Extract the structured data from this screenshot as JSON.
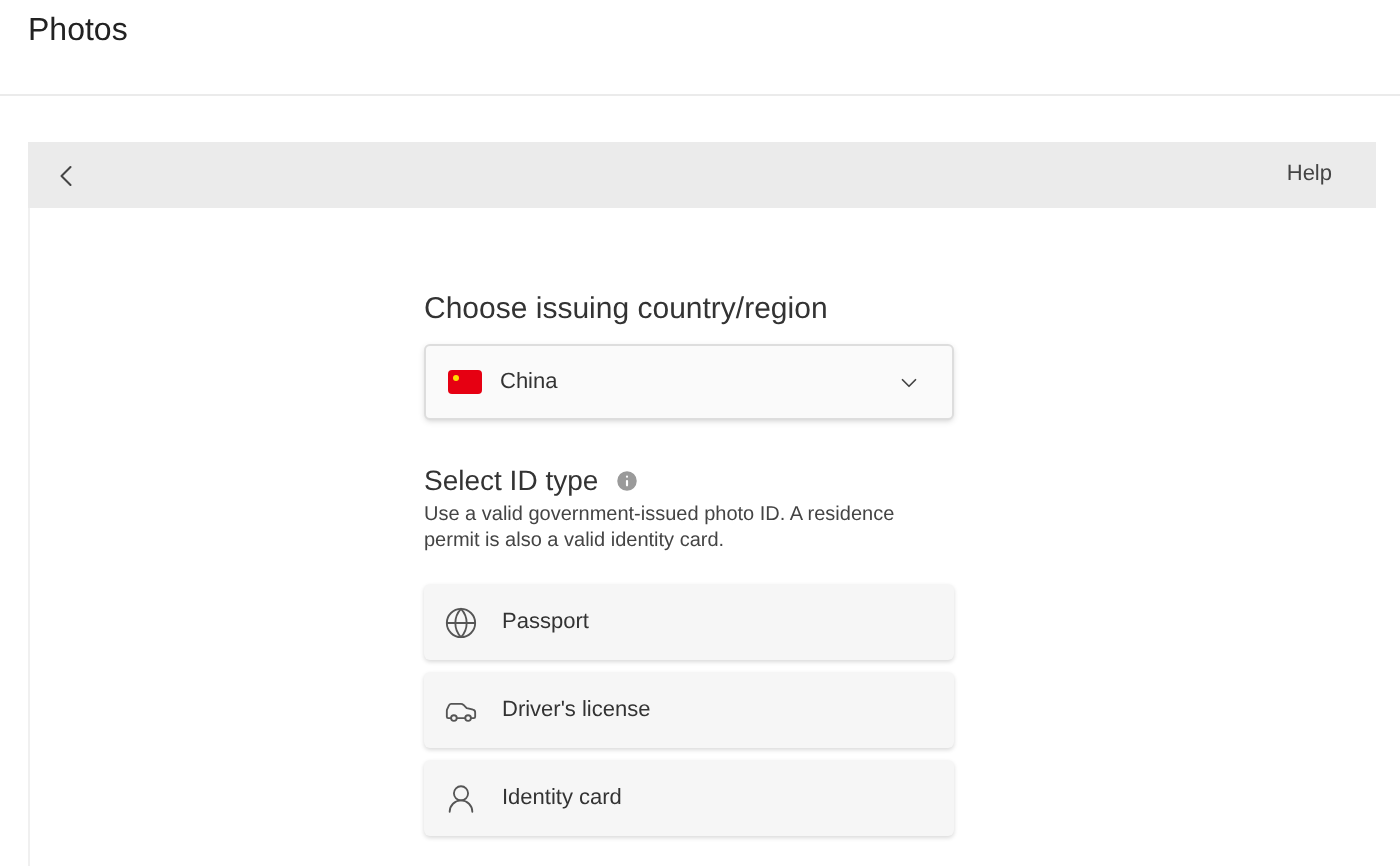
{
  "app_title": "Photos",
  "header": {
    "help": "Help"
  },
  "country": {
    "heading": "Choose issuing country/region",
    "value": "China"
  },
  "id_type": {
    "heading": "Select ID type",
    "description": "Use a valid government-issued photo ID. A residence permit is also a valid identity card.",
    "options": [
      {
        "kind": "passport",
        "label": "Passport"
      },
      {
        "kind": "license",
        "label": "Driver's license"
      },
      {
        "kind": "identity",
        "label": "Identity card"
      }
    ]
  }
}
